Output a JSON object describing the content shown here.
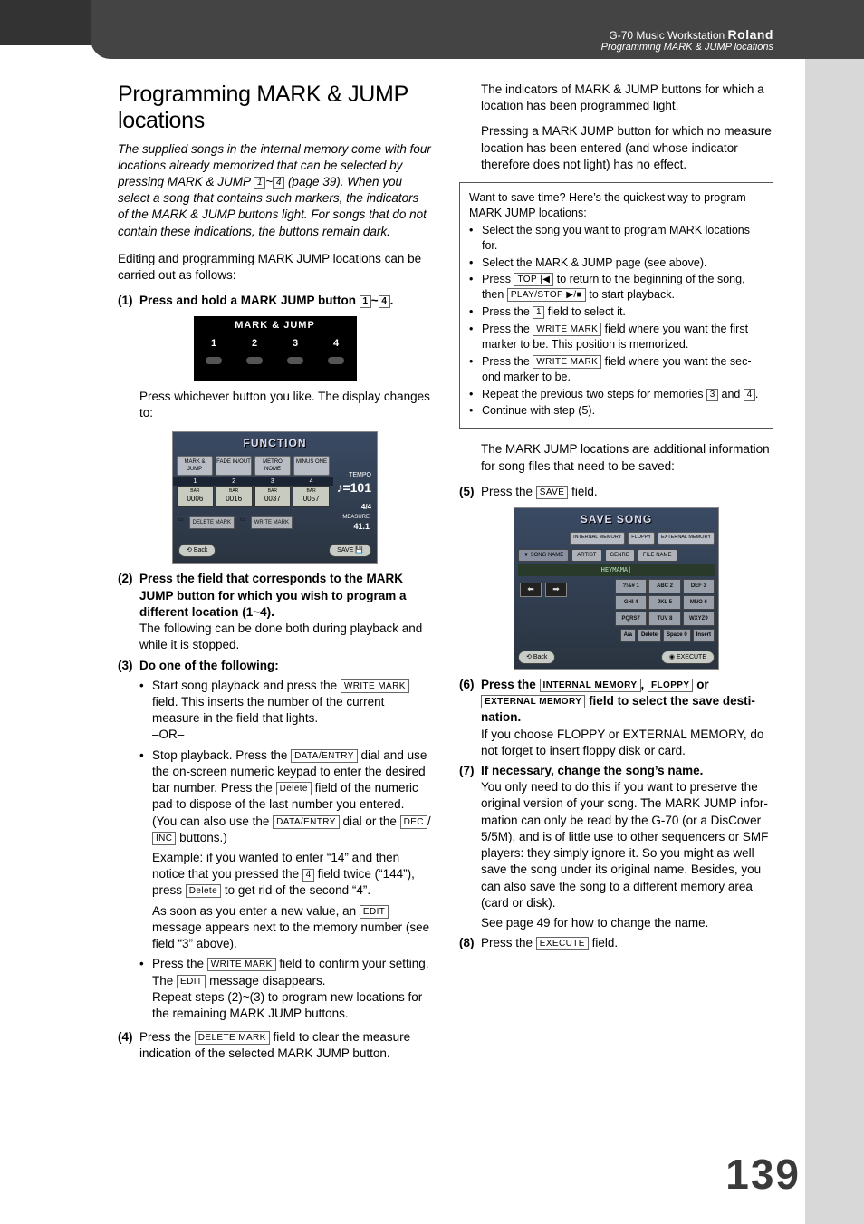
{
  "header": {
    "product": "G-70 Music Workstation",
    "brand": "Roland",
    "subtitle": "Programming MARK & JUMP locations"
  },
  "page_number": "139",
  "left": {
    "title": "Programming MARK & JUMP loca­tions",
    "intro_pre": "The supplied songs in the internal memory come with four locations already memorized that can be selected by pressing MARK & JUMP ",
    "intro_range_a": "1",
    "intro_tilde": "~",
    "intro_range_b": "4",
    "intro_post": " (page 39). When you select a song that contains such markers, the indica­tors of the MARK & JUMP buttons light. For songs that do not contain these indications, the buttons remain dark.",
    "editing_para": "Editing and programming MARK JUMP locations can be carried out as follows:",
    "step1_pre": "Press and hold a MARK JUMP button ",
    "step1_a": "1",
    "step1_tilde": "~",
    "step1_b": "4",
    "step1_post": ".",
    "markjump_title": "MARK & JUMP",
    "mj_nums": [
      "1",
      "2",
      "3",
      "4"
    ],
    "after_panel": "Press whichever button you like. The display changes to:",
    "function_title": "FUNCTION",
    "fn_tabs": [
      "MARK & JUMP",
      "FADE IN/OUT",
      "METRO NOME",
      "MINUS ONE"
    ],
    "fn_headers": [
      "1",
      "2",
      "3",
      "4"
    ],
    "fn_sub": [
      "BAR",
      "BAR",
      "BAR",
      "BAR"
    ],
    "fn_vals": [
      "0006",
      "0016",
      "0037",
      "0057"
    ],
    "fn_tempo_lbl": "TEMPO",
    "fn_tempo_val": "♪=101",
    "fn_timesig": "4/4",
    "fn_measure_lbl": "MEASURE",
    "fn_measure_val": "41.1",
    "fn_delete": "DELETE MARK",
    "fn_write": "WRITE MARK",
    "fn_back": "Back",
    "fn_save": "SAVE",
    "step2": "Press the field that corresponds to the MARK JUMP button for which you wish to program a different location (1~4).",
    "step2_follow": "The following can be done both during playback and while it is stopped.",
    "step3_heading": "Do one of the following:",
    "b1_pre": "Start song playback and press the ",
    "b1_key": "WRITE MARK",
    "b1_post": " field. This inserts the number of the current measure in the field that lights.",
    "b1_or": "–OR–",
    "b2_pre": "Stop playback. Press the ",
    "b2_key1": "DATA/ENTRY",
    "b2_mid1": " dial and use the on-screen numeric keypad to enter the desired bar number. Press the ",
    "b2_key2": "Delete",
    "b2_mid2": " field of the numeric pad to dispose of the last number you entered. (You can also use the ",
    "b2_key3": "DATA/ENTRY",
    "b2_mid3": " dial or the ",
    "b2_key4": "DEC",
    "b2_slash": "/",
    "b2_key5": "INC",
    "b2_post": " buttons.)",
    "b2_example_pre": "Example: if you wanted to enter “14” and then notice that you pressed the ",
    "b2_ex_key": "4",
    "b2_example_mid": " field twice (“144”), press ",
    "b2_ex_key2": "Delete",
    "b2_example_post": " to get rid of the second “4”.",
    "b2_assoon_pre": "As soon as you enter a new value, an ",
    "b2_assoon_key": "EDIT",
    "b2_assoon_post": " message appears next to the memory number (see field “3” above).",
    "b3_pre": "Press the ",
    "b3_key": "WRITE MARK",
    "b3_mid": " field to confirm your set­ting. The ",
    "b3_key2": "EDIT",
    "b3_post": " message disappears.",
    "b3_repeat": "Repeat steps (2)~(3) to program new locations for the remaining MARK JUMP buttons.",
    "step4_pre": "Press the ",
    "step4_key": "DELETE MARK",
    "step4_post": " field to clear the measure indication of the selected MARK JUMP button."
  },
  "right": {
    "para1": "The indicators of MARK & JUMP buttons for which a location has been programmed light.",
    "para2": "Pressing a MARK JUMP button for which no measure location has been entered (and whose indicator therefore does not light) has no effect.",
    "tip_intro": "Want to save time? Here’s the quickest way to program MARK JUMP locations:",
    "tip1": "Select the song you want to program MARK locations for.",
    "tip2": "Select the MARK & JUMP page (see above).",
    "tip3_pre": "Press ",
    "tip3_key1": "TOP |◀",
    "tip3_mid": " to return to the beginning of the song, then ",
    "tip3_key2": "PLAY/STOP ▶/■",
    "tip3_post": " to start playback.",
    "tip4_pre": "Press the ",
    "tip4_key": "1",
    "tip4_post": " field to select it.",
    "tip5_pre": "Press the ",
    "tip5_key": "WRITE MARK",
    "tip5_post": " field where you want the first marker to be. This position is memorized.",
    "tip6_pre": "Press the ",
    "tip6_key": "WRITE MARK",
    "tip6_post": " field where you want the sec­ond marker to be.",
    "tip7_pre": "Repeat the previous two steps for memories ",
    "tip7_a": "3",
    "tip7_and": " and ",
    "tip7_b": "4",
    "tip7_post": ".",
    "tip8": "Continue with step (5).",
    "after_tip": "The MARK JUMP locations are additional information for song files that need to be saved:",
    "step5_pre": "Press the ",
    "step5_key": "SAVE",
    "step5_post": " field.",
    "save_title": "SAVE SONG",
    "save_dest": [
      "INTERNAL MEMORY",
      "FLOPPY",
      "EXTERNAL MEMORY"
    ],
    "save_songname_lbl": "SONG NAME",
    "save_artist": "ARTIST",
    "save_genre": "GENRE",
    "save_filename": "FILE NAME",
    "save_name_val": "HEYMAMA|",
    "keypad": [
      "?!&# 1",
      "ABC 2",
      "DEF 3",
      "GHI 4",
      "JKL 5",
      "MNO 6",
      "PQRS7",
      "TUV 8",
      "WXYZ9"
    ],
    "fnkeys": [
      "A/a",
      "Delete",
      "Space 0",
      "Insert"
    ],
    "save_back": "Back",
    "save_execute": "EXECUTE",
    "step6_pre": "Press the ",
    "step6_k1": "INTERNAL MEMORY",
    "step6_c1": ", ",
    "step6_k2": "FLOPPY",
    "step6_c2": " or ",
    "step6_k3": "EXTERNAL MEMORY",
    "step6_post": " field to select the save desti­nation.",
    "step6_follow": "If you choose FLOPPY or EXTERNAL MEMORY, do not forget to insert floppy disk or card.",
    "step7_heading": "If necessary, change the song’s name.",
    "step7_body": "You only need to do this if you want to preserve the original version of your song. The MARK JUMP infor­mation can only be read by the G-70 (or a DisCover 5/5M), and is of little use to other sequenc­ers or SMF players: they simply ignore it. So you might as well save the song under its original name. Besides, you can also save the song to a different memory area (card or disk).",
    "step7_see": "See page 49 for how to change the name.",
    "step8_pre": "Press the ",
    "step8_key": "EXECUTE",
    "step8_post": " field."
  }
}
